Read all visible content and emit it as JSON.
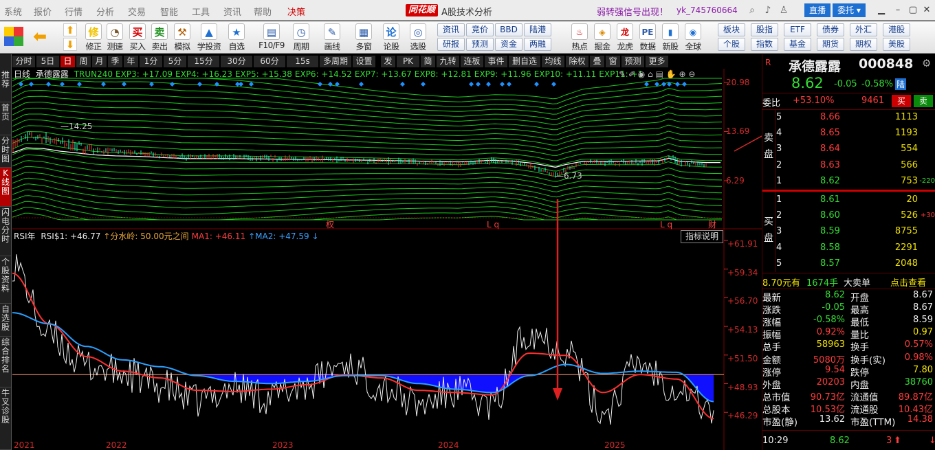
{
  "menubar": {
    "items": [
      "系统",
      "报价",
      "行情",
      "分析",
      "交易",
      "智能",
      "工具",
      "资讯",
      "帮助",
      "决策"
    ],
    "active_index": 9,
    "logo": "同花顺",
    "title": "A股技术分析",
    "alert": "弱转强信号出现！",
    "user": "yk_745760664",
    "live": "直播",
    "entrust": "委托"
  },
  "toolbar": {
    "big": [
      {
        "label": "修正",
        "icon": "修",
        "color": "#f2c200"
      },
      {
        "label": "测速",
        "icon": "◔",
        "color": "#7a5a2a"
      },
      {
        "label": "买入",
        "icon": "买",
        "color": "#d40000"
      },
      {
        "label": "卖出",
        "icon": "卖",
        "color": "#1f8f1f"
      },
      {
        "label": "模拟",
        "icon": "⚒",
        "color": "#b25b00"
      },
      {
        "label": "学投资",
        "icon": "▲",
        "color": "#1d6fd2"
      },
      {
        "label": "自选",
        "icon": "★",
        "color": "#1d6fd2"
      },
      {
        "label": "F10/F9",
        "icon": "▤",
        "color": "#2a5aa8"
      },
      {
        "label": "周期",
        "icon": "◷",
        "color": "#2a5aa8"
      },
      {
        "label": "画线",
        "icon": "✎",
        "color": "#2a5aa8"
      },
      {
        "label": "多窗",
        "icon": "▦",
        "color": "#2a5aa8"
      },
      {
        "label": "论股",
        "icon": "论",
        "color": "#1d6fd2"
      },
      {
        "label": "选股",
        "icon": "◎",
        "color": "#2a5aa8"
      }
    ],
    "small_top": [
      "资讯",
      "竞价",
      "BBD",
      "陆港"
    ],
    "small_bottom": [
      "研报",
      "预测",
      "资金",
      "两融"
    ],
    "big2": [
      {
        "label": "热点",
        "icon": "♨",
        "color": "#d40000"
      },
      {
        "label": "掘金",
        "icon": "◈",
        "color": "#d98a00"
      },
      {
        "label": "龙虎",
        "icon": "龙",
        "color": "#d40000"
      },
      {
        "label": "数据",
        "icon": "PE",
        "color": "#2a5aa8"
      },
      {
        "label": "新股",
        "icon": "▮",
        "color": "#1d6fd2"
      },
      {
        "label": "全球",
        "icon": "◉",
        "color": "#1d6fd2"
      }
    ],
    "small2_top": [
      "板块",
      "股指",
      "ETF",
      "债券",
      "外汇",
      "港股"
    ],
    "small2_bottom": [
      "个股",
      "指数",
      "基金",
      "期货",
      "期权",
      "美股"
    ]
  },
  "leftnav": [
    {
      "label": "推荐",
      "sel": false
    },
    {
      "label": "首页",
      "sel": false
    },
    {
      "label": "分时图",
      "sel": false
    },
    {
      "label": "K线图",
      "sel": true
    },
    {
      "label": "闪电分时",
      "sel": false
    },
    {
      "label": "个股资料",
      "sel": false
    },
    {
      "label": "自选股",
      "sel": false
    },
    {
      "label": "综合排名",
      "sel": false
    },
    {
      "label": "牛叉诊股",
      "sel": false
    }
  ],
  "periods": [
    {
      "label": "分时",
      "sel": false
    },
    {
      "label": "5日",
      "sel": false
    },
    {
      "label": "日",
      "sel": true
    },
    {
      "label": "周",
      "sel": false
    },
    {
      "label": "月",
      "sel": false
    },
    {
      "label": "季",
      "sel": false
    },
    {
      "label": "年",
      "sel": false
    },
    {
      "label": "1分",
      "sel": false
    },
    {
      "label": "5分",
      "sel": false
    },
    {
      "label": "15分",
      "sel": false
    },
    {
      "label": "30分",
      "sel": false
    },
    {
      "label": "60分",
      "sel": false
    },
    {
      "label": "15s",
      "sel": false
    },
    {
      "label": "多周期",
      "sel": false
    },
    {
      "label": "设置",
      "sel": false
    },
    {
      "label": "发",
      "sel": false
    },
    {
      "label": "PK",
      "sel": false
    },
    {
      "label": "简",
      "sel": false
    },
    {
      "label": "九转",
      "sel": false
    },
    {
      "label": "连板",
      "sel": false
    },
    {
      "label": "事件",
      "sel": false
    },
    {
      "label": "删自选",
      "sel": false
    },
    {
      "label": "均线",
      "sel": false
    },
    {
      "label": "除权",
      "sel": false
    },
    {
      "label": "叠",
      "sel": false
    },
    {
      "label": "窗",
      "sel": false
    },
    {
      "label": "预测",
      "sel": false
    },
    {
      "label": "更多",
      "sel": false
    }
  ],
  "kchart": {
    "period": "日线",
    "stock": "承德露露",
    "items": [
      {
        "t": "TRUN240",
        "c": "#33dd33"
      },
      {
        "t": "EXP3: +17.09",
        "c": "#33dd33"
      },
      {
        "t": "EXP4: +16.23",
        "c": "#33dd33"
      },
      {
        "t": "EXP5: +15.38",
        "c": "#33dd33"
      },
      {
        "t": "EXP6: +14.52",
        "c": "#33dd33"
      },
      {
        "t": "EXP7: +13.67",
        "c": "#33dd33"
      },
      {
        "t": "EXP8: +12.81",
        "c": "#33dd33"
      },
      {
        "t": "EXP9: +11.96",
        "c": "#33dd33"
      },
      {
        "t": "EXP10: +11.11",
        "c": "#33dd33"
      },
      {
        "t": "EXP11: +1",
        "c": "#33dd33"
      }
    ],
    "axis": [
      "20.98",
      "13.69",
      "6.29"
    ],
    "hi_label": "14.25",
    "lo_label": "6.73",
    "markers": [
      "权",
      "L q",
      "L q",
      "财"
    ]
  },
  "rsi": {
    "name": "RSI年",
    "items": [
      {
        "t": "RSI$1: +46.77",
        "c": "#eeeeee"
      },
      {
        "t": "↑分水岭: 50.00元之间",
        "c": "#e8a53a"
      },
      {
        "t": "MA1: +46.11",
        "c": "#ff3b3b"
      },
      {
        "t": "↑MA2: +47.59 ↓",
        "c": "#3aa0ff"
      }
    ],
    "explain": "指标说明",
    "axis": [
      "+61.91",
      "+59.34",
      "+56.70",
      "+54.13",
      "+51.50",
      "+48.93",
      "+46.29"
    ],
    "years": [
      "2021",
      "2022",
      "2023",
      "2024",
      "2025"
    ]
  },
  "chart_data": {
    "type": "line",
    "title": "",
    "xlabel": "",
    "ylabel": "",
    "x": [
      "2021",
      "2022",
      "2023",
      "2024",
      "2025"
    ],
    "price_axis": [
      6.29,
      20.98
    ],
    "price_labels": {
      "high": 14.25,
      "low": 6.73
    },
    "rsi_axis": [
      46.29,
      61.91
    ],
    "series": [
      {
        "name": "RSI$1",
        "values": [
          59.9,
          53.4,
          50.8,
          50.1,
          49.0,
          47.6,
          48.9,
          48.0,
          49.2,
          51.0,
          49.0,
          47.3,
          48.5,
          47.2,
          53.9,
          52.3,
          46.7,
          51.0,
          48.9,
          46.8
        ]
      },
      {
        "name": "MA1",
        "values": [
          59.0,
          54.5,
          51.6,
          50.3,
          49.7,
          48.6,
          48.5,
          48.7,
          49.1,
          50.0,
          49.7,
          48.6,
          48.4,
          48.2,
          51.9,
          51.7,
          48.4,
          50.0,
          49.6,
          46.1
        ]
      },
      {
        "name": "MA2",
        "values": [
          55.5,
          54.5,
          52.5,
          51.3,
          50.7,
          49.9,
          49.4,
          49.2,
          49.4,
          49.9,
          49.9,
          49.2,
          48.7,
          48.4,
          49.9,
          50.9,
          50.1,
          50.3,
          50.2,
          47.6
        ]
      }
    ],
    "threshold": 50.0
  },
  "quote": {
    "code": "000848",
    "name": "承德露露",
    "price": "8.62",
    "change": "-0.05",
    "pct": "-0.58%",
    "tag": "陆",
    "weibi_label": "委比",
    "weibi": "+53.10%",
    "weicha": "9461",
    "buy": "买",
    "sell": "卖",
    "sell_label": "卖盘",
    "buy_label": "买盘",
    "asks": [
      {
        "lvl": "5",
        "p": "8.66",
        "v": "1113",
        "chg": ""
      },
      {
        "lvl": "4",
        "p": "8.65",
        "v": "1193",
        "chg": ""
      },
      {
        "lvl": "3",
        "p": "8.64",
        "v": "554",
        "chg": ""
      },
      {
        "lvl": "2",
        "p": "8.63",
        "v": "566",
        "chg": ""
      },
      {
        "lvl": "1",
        "p": "8.62",
        "v": "753",
        "chg": "-220"
      }
    ],
    "bids": [
      {
        "lvl": "1",
        "p": "8.61",
        "v": "20",
        "chg": ""
      },
      {
        "lvl": "2",
        "p": "8.60",
        "v": "526",
        "chg": "+30"
      },
      {
        "lvl": "3",
        "p": "8.59",
        "v": "8755",
        "chg": ""
      },
      {
        "lvl": "4",
        "p": "8.58",
        "v": "2291",
        "chg": ""
      },
      {
        "lvl": "5",
        "p": "8.57",
        "v": "2048",
        "chg": ""
      }
    ],
    "big_order": {
      "price": "8.70元有",
      "qty": "1674手",
      "label": "大卖单",
      "link": "点击查看"
    },
    "stats": [
      [
        "最新",
        "8.62",
        "开盘",
        "8.67"
      ],
      [
        "涨跌",
        "-0.05",
        "最高",
        "8.67"
      ],
      [
        "涨幅",
        "-0.58%",
        "最低",
        "8.59"
      ],
      [
        "振幅",
        "0.92%",
        "量比",
        "0.97"
      ],
      [
        "总手",
        "58963",
        "换手",
        "0.57%"
      ],
      [
        "金额",
        "5080万",
        "换手(实)",
        "0.98%"
      ],
      [
        "涨停",
        "9.54",
        "跌停",
        "7.80"
      ],
      [
        "外盘",
        "20203",
        "内盘",
        "38760"
      ],
      [
        "总市值",
        "90.73亿",
        "流通值",
        "89.87亿"
      ],
      [
        "总股本",
        "10.53亿",
        "流通股",
        "10.43亿"
      ],
      [
        "市盈(静)",
        "13.62",
        "市盈(TTM)",
        "14.38"
      ]
    ],
    "last": {
      "time": "10:29",
      "price": "8.62",
      "vol": "3"
    }
  }
}
